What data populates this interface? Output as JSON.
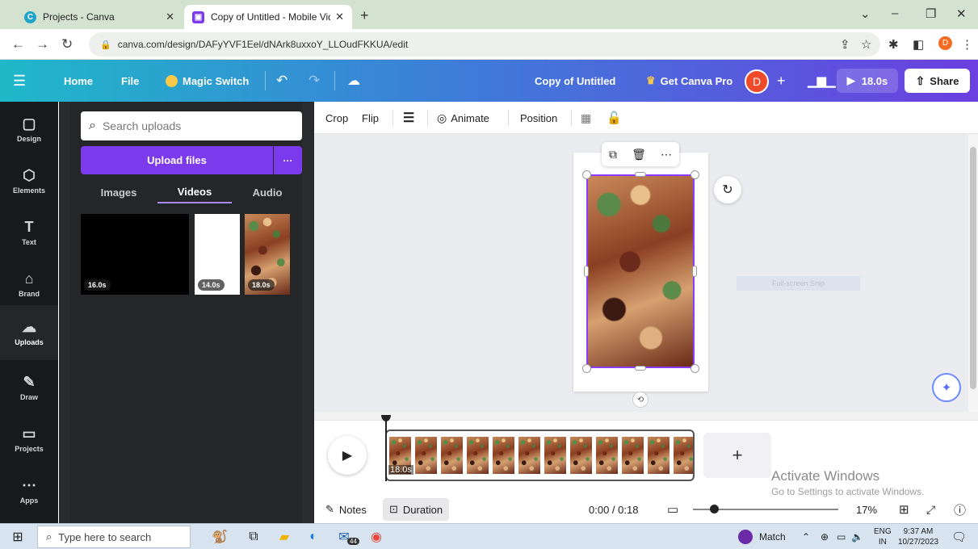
{
  "browser": {
    "tabs": [
      {
        "title": "Projects - Canva",
        "active": false
      },
      {
        "title": "Copy of Untitled - Mobile Video",
        "active": true
      }
    ],
    "url": "canva.com/design/DAFyYVF1Eel/dNArk8uxxoY_LLOudFKKUA/edit",
    "profile_initial": "D"
  },
  "header": {
    "home": "Home",
    "file": "File",
    "magic_switch": "Magic Switch",
    "doc_title": "Copy of Untitled",
    "get_pro": "Get Canva Pro",
    "avatar": "D",
    "play_duration": "18.0s",
    "share": "Share"
  },
  "rail": [
    {
      "label": "Design",
      "icon": "▢"
    },
    {
      "label": "Elements",
      "icon": "⬡"
    },
    {
      "label": "Text",
      "icon": "T"
    },
    {
      "label": "Brand",
      "icon": "⌂"
    },
    {
      "label": "Uploads",
      "icon": "☁"
    },
    {
      "label": "Draw",
      "icon": "✎"
    },
    {
      "label": "Projects",
      "icon": "▭"
    },
    {
      "label": "Apps",
      "icon": "⋯"
    }
  ],
  "uploads": {
    "search_placeholder": "Search uploads",
    "upload_button": "Upload files",
    "more": "···",
    "tabs": [
      "Images",
      "Videos",
      "Audio"
    ],
    "active_tab": "Videos",
    "videos": [
      {
        "duration": "16.0s",
        "style": "black"
      },
      {
        "duration": "14.0s",
        "style": "white"
      },
      {
        "duration": "18.0s",
        "style": "food"
      }
    ]
  },
  "toolbar": {
    "crop": "Crop",
    "flip": "Flip",
    "animate": "Animate",
    "position": "Position"
  },
  "canvas": {
    "overlay_text": "Full-screen Snip"
  },
  "timeline": {
    "clip_duration": "18.0s",
    "notes": "Notes",
    "duration": "Duration",
    "time": "0:00 / 0:18",
    "zoom": "17%"
  },
  "watermark": {
    "title": "Activate Windows",
    "subtitle": "Go to Settings to activate Windows."
  },
  "taskbar": {
    "search_placeholder": "Type here to search",
    "mail_badge": "44",
    "match_label": "Match",
    "lang": "ENG",
    "region": "IN",
    "time": "9:37 AM",
    "date": "10/27/2023"
  }
}
